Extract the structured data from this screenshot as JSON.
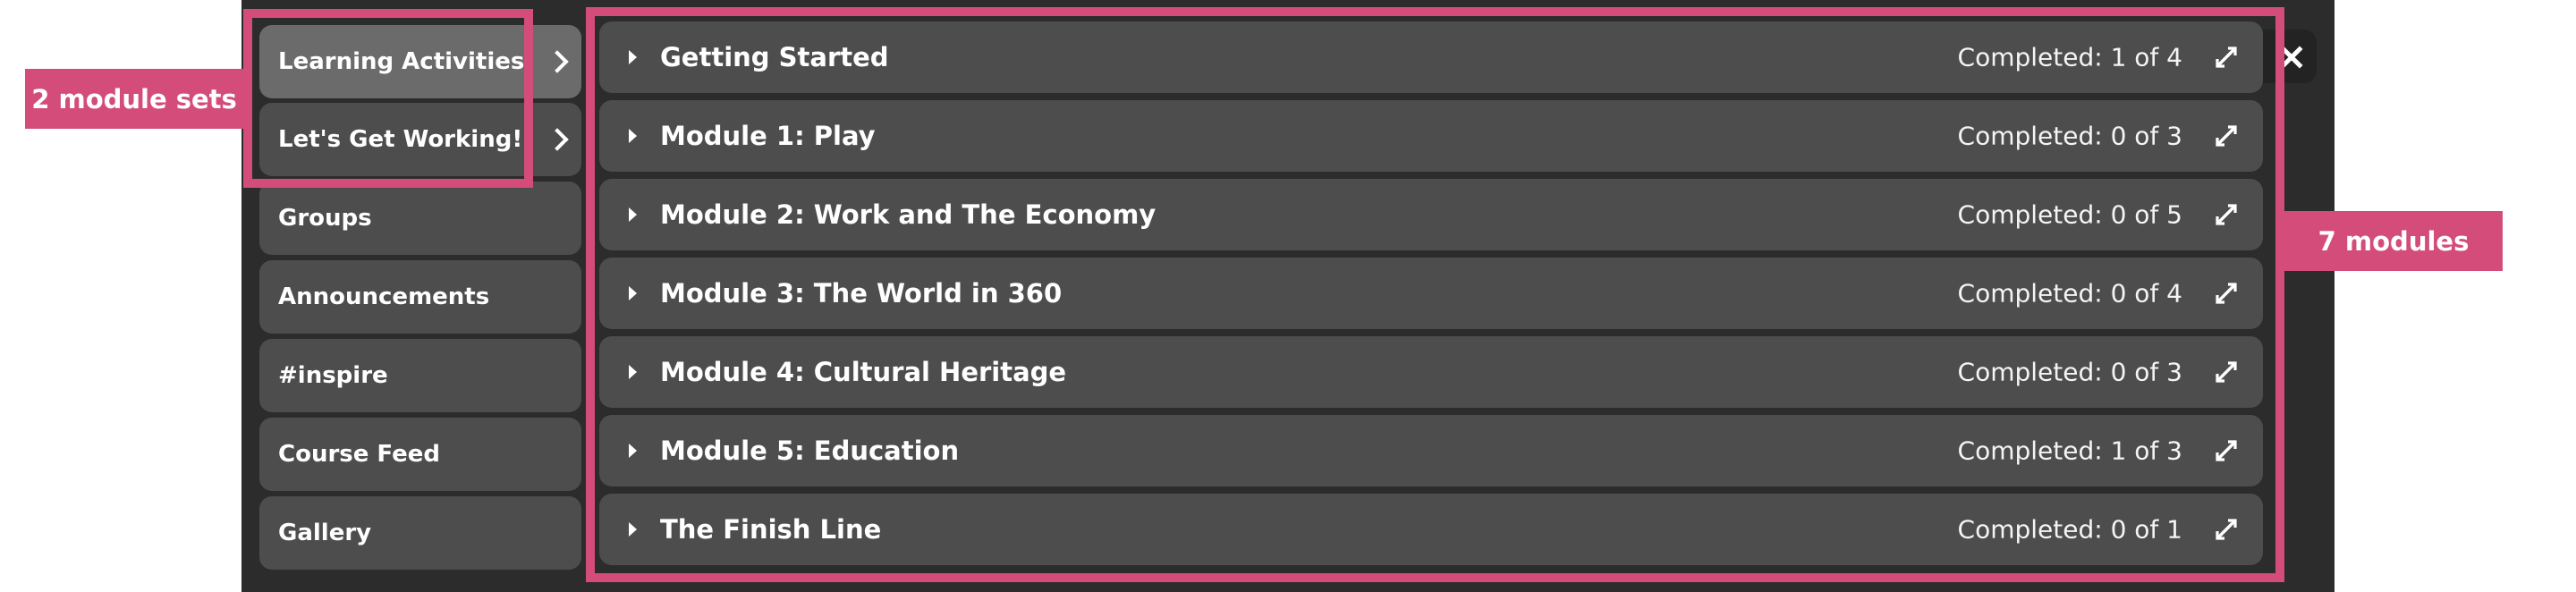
{
  "sidebar": {
    "items": [
      {
        "label": "Learning Activities",
        "has_submenu": true,
        "active": true
      },
      {
        "label": "Let's Get Working!",
        "has_submenu": true,
        "active": false
      },
      {
        "label": "Groups",
        "has_submenu": false,
        "active": false
      },
      {
        "label": "Announcements",
        "has_submenu": false,
        "active": false
      },
      {
        "label": "#inspire",
        "has_submenu": false,
        "active": false
      },
      {
        "label": "Course Feed",
        "has_submenu": false,
        "active": false
      },
      {
        "label": "Gallery",
        "has_submenu": false,
        "active": false
      }
    ]
  },
  "modules": [
    {
      "title": "Getting Started",
      "status": "Completed: 1 of 4",
      "completed": 1,
      "total": 4
    },
    {
      "title": "Module 1: Play",
      "status": "Completed: 0 of 3",
      "completed": 0,
      "total": 3
    },
    {
      "title": "Module 2: Work and The Economy",
      "status": "Completed: 0 of 5",
      "completed": 0,
      "total": 5
    },
    {
      "title": "Module 3: The World in 360",
      "status": "Completed: 0 of 4",
      "completed": 0,
      "total": 4
    },
    {
      "title": "Module 4: Cultural Heritage",
      "status": "Completed: 0 of 3",
      "completed": 0,
      "total": 3
    },
    {
      "title": "Module 5: Education",
      "status": "Completed: 1 of 3",
      "completed": 1,
      "total": 3
    },
    {
      "title": "The Finish Line",
      "status": "Completed: 0 of 1",
      "completed": 0,
      "total": 1
    }
  ],
  "close_button": {
    "icon": "close-icon"
  },
  "annotations": {
    "module_sets_label": "2 module sets",
    "modules_label": "7 modules",
    "highlight_color": "#d44d7a"
  },
  "icons": {
    "submenu": "chevron-right-icon",
    "row_toggle": "caret-right-icon",
    "row_expand": "expand-arrows-icon"
  }
}
